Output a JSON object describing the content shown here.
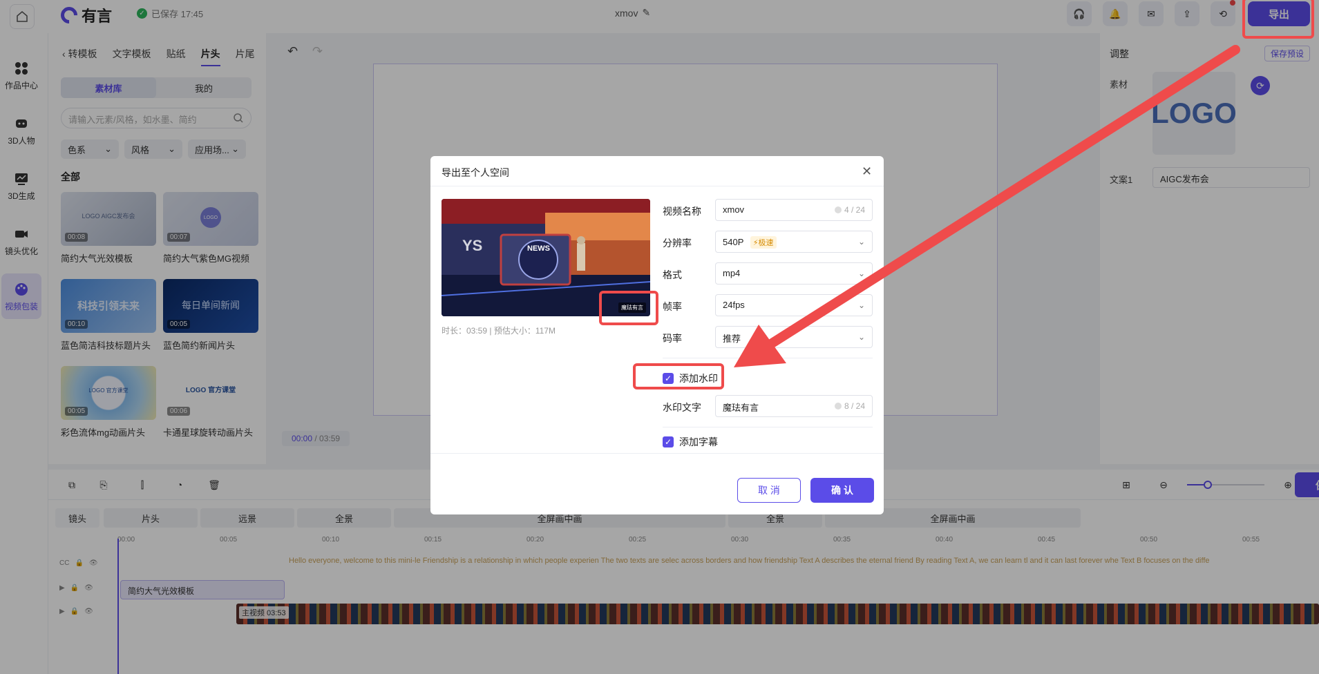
{
  "app": {
    "brand": "有言",
    "saved_status": "已保存 17:45",
    "project_title": "xmov",
    "export_label": "导出"
  },
  "rail": [
    {
      "label": "作品中心",
      "icon": "grid-icon"
    },
    {
      "label": "3D人物",
      "icon": "robot-icon"
    },
    {
      "label": "3D生成",
      "icon": "chart-screen-icon"
    },
    {
      "label": "镜头优化",
      "icon": "camera-icon"
    },
    {
      "label": "视频包装",
      "icon": "palette-icon"
    }
  ],
  "panel": {
    "back_tab": "‹ 转模板",
    "tabs": [
      "文字模板",
      "贴纸",
      "片头",
      "片尾"
    ],
    "active_tab": "片头",
    "segments": [
      "素材库",
      "我的"
    ],
    "search_placeholder": "请输入元素/风格，如水墨、简约",
    "filters": [
      "色系",
      "风格",
      "应用场..."
    ],
    "section_title": "全部",
    "cards": [
      {
        "title": "简约大气光效模板",
        "duration": "00:08",
        "thumb_text": "LOGO AIGC发布会"
      },
      {
        "title": "简约大气紫色MG视频",
        "duration": "00:07",
        "thumb_text": "LOGO"
      },
      {
        "title": "蓝色简洁科技标题片头",
        "duration": "00:10",
        "thumb_text": "科技引领未来"
      },
      {
        "title": "蓝色简约新闻片头",
        "duration": "00:05",
        "thumb_text": "每日单间新闻"
      },
      {
        "title": "彩色流体mg动画片头",
        "duration": "00:05",
        "thumb_text": "LOGO 官方课堂"
      },
      {
        "title": "卡通星球旋转动画片头",
        "duration": "00:06",
        "thumb_text": "LOGO 官方课堂"
      }
    ]
  },
  "stage": {
    "time_current": "00:00",
    "time_total": "/ 03:59"
  },
  "right_panel": {
    "title": "调整",
    "save_preset": "保存预设",
    "material_label": "素材",
    "logo_text": "LOGO",
    "copy_label": "文案1",
    "copy_value": "AIGC发布会"
  },
  "toolbar": {
    "save_label": "保存"
  },
  "timeline": {
    "shots": [
      "镜头",
      "片头",
      "远景",
      "全景",
      "全屏画中画",
      "全景",
      "全屏画中画"
    ],
    "ticks": [
      "00:00",
      "00:05",
      "00:10",
      "00:15",
      "00:20",
      "00:25",
      "00:30",
      "00:35",
      "00:40",
      "00:45",
      "00:50",
      "00:55"
    ],
    "subtitles": "Hello everyone, welcome to this mini-le Friendship is a relationship in which people experien The two texts are selec across borders and how friendship   Text A describes the eternal friend By reading Text A, we can learn tl and it can last forever whe   Text B focuses on the diffe",
    "package_clip": "简约大气光效模板",
    "main_clip": "主视频 03:53"
  },
  "dialog": {
    "title": "导出至个人空间",
    "preview_meta": "时长：03:59 | 预估大小：117M",
    "preview_watermark": "魔珐有言",
    "preview_news": "NEWS",
    "fields": {
      "name_label": "视频名称",
      "name_value": "xmov",
      "name_count": "4 / 24",
      "res_label": "分辨率",
      "res_value": "540P",
      "res_badge": "极速",
      "format_label": "格式",
      "format_value": "mp4",
      "fps_label": "帧率",
      "fps_value": "24fps",
      "bitrate_label": "码率",
      "bitrate_value": "推荐"
    },
    "watermark_check": "添加水印",
    "watermark_text_label": "水印文字",
    "watermark_text_value": "魔珐有言",
    "watermark_count": "8 / 24",
    "subtitle_check": "添加字幕",
    "cancel": "取 消",
    "confirm": "确 认"
  },
  "colors": {
    "accent": "#5b4ce8",
    "highlight": "#ef4b4b"
  }
}
